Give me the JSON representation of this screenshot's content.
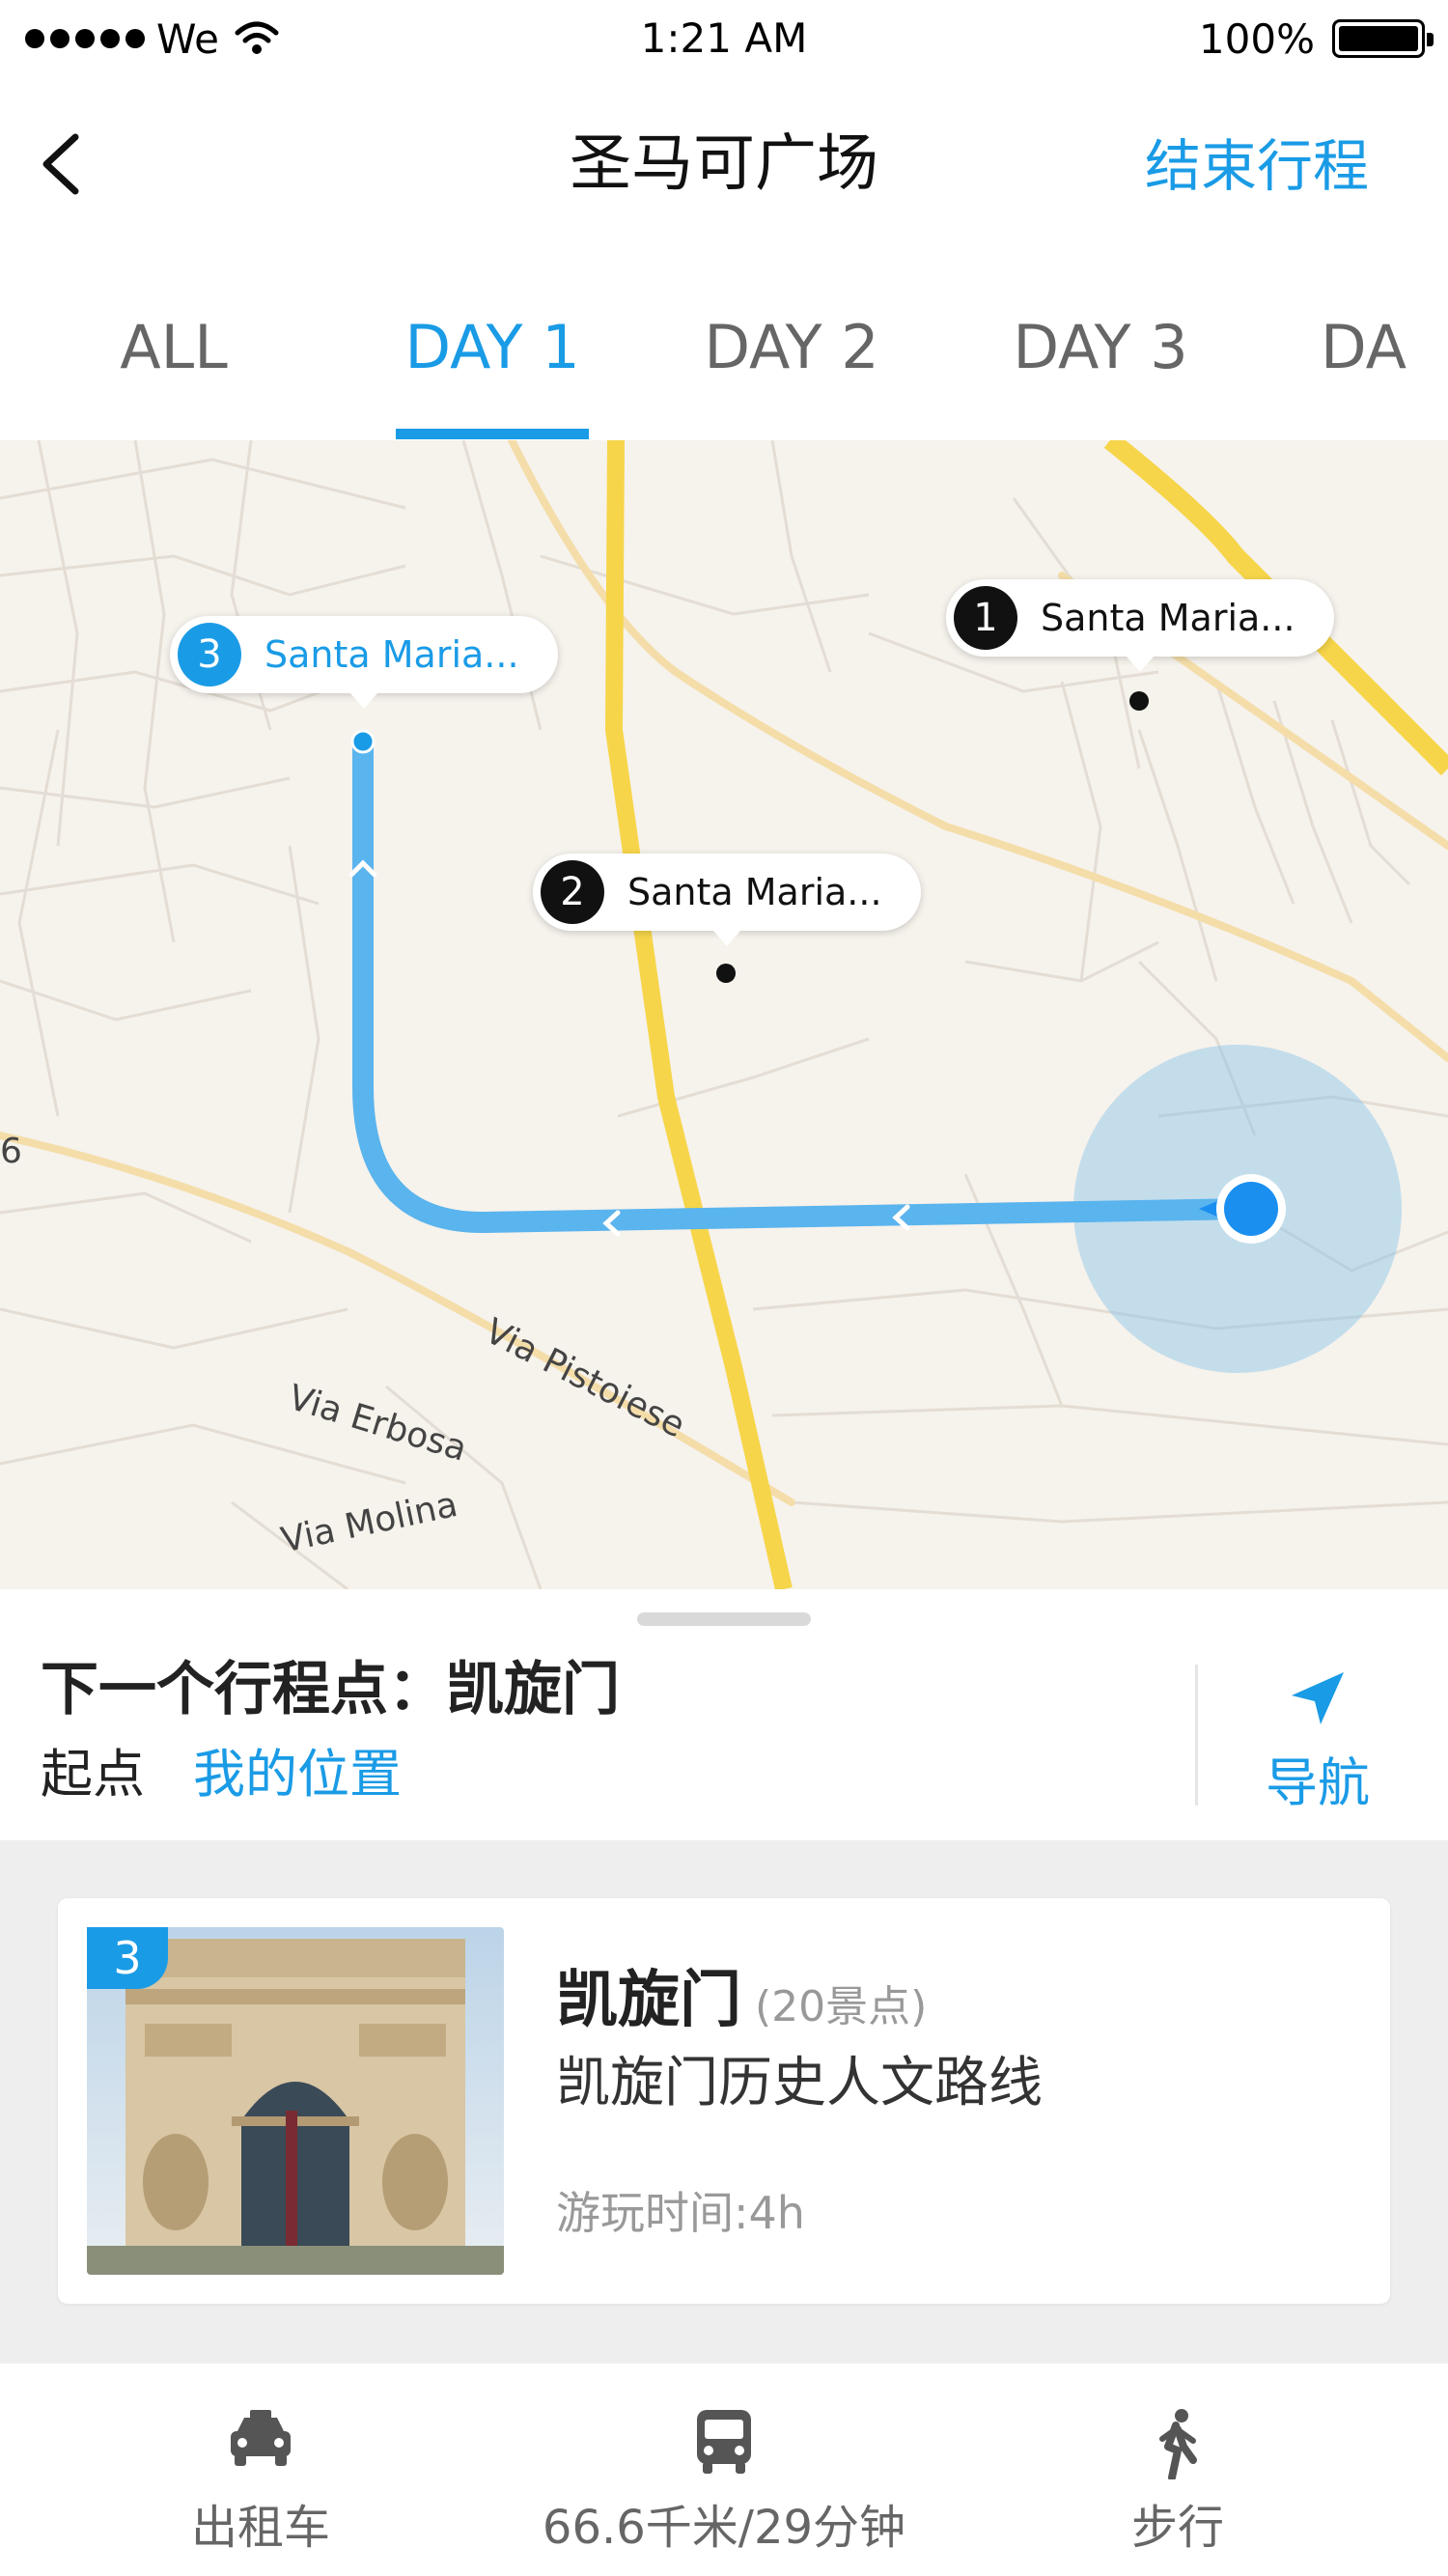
{
  "status_bar": {
    "carrier": "We",
    "time": "1:21 AM",
    "battery_text": "100%",
    "battery_level": 1.0
  },
  "header": {
    "title": "圣马可广场",
    "action_label": "结束行程",
    "back_icon": "chevron-left-icon"
  },
  "tabs": [
    {
      "label": "ALL",
      "active": false
    },
    {
      "label": "DAY 1",
      "active": true
    },
    {
      "label": "DAY 2",
      "active": false
    },
    {
      "label": "DAY 3",
      "active": false
    },
    {
      "label": "DA",
      "active": false
    }
  ],
  "map": {
    "street_labels": [
      "Via Pistoiese",
      "Via Erbosa",
      "Via Molina",
      "6"
    ],
    "pins": [
      {
        "number": "1",
        "label": "Santa Maria..."
      },
      {
        "number": "2",
        "label": "Santa Maria..."
      },
      {
        "number": "3",
        "label": "Santa Maria..."
      }
    ],
    "route_color": "#5ab4ee",
    "location_color": "#1a8ff0"
  },
  "next_point": {
    "title": "下一个行程点：凯旋门",
    "start_label": "起点",
    "start_value": "我的位置",
    "nav_label": "导航"
  },
  "card": {
    "badge": "3",
    "title": "凯旋门",
    "count": "(20景点)",
    "subtitle": "凯旋门历史人文路线",
    "meta": "游玩时间:4h"
  },
  "transport": [
    {
      "label": "出租车",
      "icon": "taxi-icon"
    },
    {
      "label": "66.6千米/29分钟",
      "icon": "bus-icon"
    },
    {
      "label": "步行",
      "icon": "walk-icon"
    }
  ],
  "colors": {
    "accent": "#1a9be6",
    "map_bg": "#f6f2ec",
    "road_yellow": "#f6d54a"
  }
}
